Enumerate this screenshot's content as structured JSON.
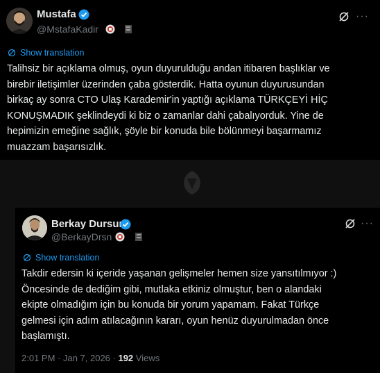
{
  "tweet": {
    "author_name": "Mustafa",
    "author_handle": "@MstafaKadir",
    "translate_label": "Show translation",
    "text": "Talihsiz bir açıklama olmuş, oyun duyurulduğu andan itibaren başlıklar ve\nbirebir iletişimler üzerinden çaba gösterdik. Hatta oyunun duyurusundan\nbirkaç ay sonra CTO Ulaş Karademir'in yaptığı açıklama TÜRKÇEYİ HİÇ\nKONUŞMADIK şeklindeydi ki biz o zamanlar dahi çabalıyorduk. Yine de\nhepimizin emeğine sağlık, şöyle bir konuda bile bölünmeyi başarmamız\nmuazzam başarısızlık.",
    "more_label": "···"
  },
  "quoted": {
    "author_name": "Berkay Dursun",
    "author_handle": "@BerkayDrsn",
    "translate_label": "Show translation",
    "text": "Takdir edersin ki içeride yaşanan gelişmeler hemen size yansıtılmıyor :)\nÖncesinde de dediğim gibi, mutlaka etkiniz olmuştur, ben o alandaki\nekipte olmadığım için bu konuda bir yorum yapamam. Fakat Türkçe\ngelmesi için adım atılacağının kararı, oyun henüz duyurulmadan önce\nbaşlamıştı.",
    "timestamp": "2:01 PM · Jan 7, 2026 · ",
    "views_count": "192",
    "views_label": " Views",
    "more_label": "···"
  },
  "colors": {
    "background": "#000000",
    "link": "#1d9bf0",
    "verified": "#1d9bf0",
    "secondary_text": "#71767b"
  },
  "icons": [
    "verified-badge-icon",
    "grok-icon",
    "more-icon",
    "translate-icon"
  ]
}
